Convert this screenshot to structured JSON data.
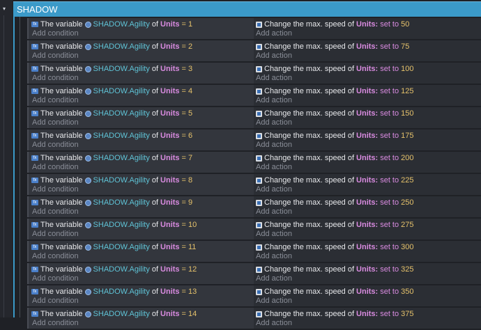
{
  "group": {
    "title": "SHADOW",
    "collapse_symbol": "▾"
  },
  "labels": {
    "the_variable": "The variable",
    "of": "of",
    "add_condition": "Add condition",
    "add_action": "Add action",
    "change_speed": "Change the max. speed of",
    "set_to": "set to"
  },
  "events": [
    {
      "variable": "SHADOW.Agility",
      "object": "Units",
      "op": "=",
      "value": "1",
      "act_object": "Units:",
      "act_value": "50"
    },
    {
      "variable": "SHADOW.Agility",
      "object": "Units",
      "op": "=",
      "value": "2",
      "act_object": "Units:",
      "act_value": "75"
    },
    {
      "variable": "SHADOW.Agility",
      "object": "Units",
      "op": "=",
      "value": "3",
      "act_object": "Units:",
      "act_value": "100"
    },
    {
      "variable": "SHADOW.Agility",
      "object": "Units",
      "op": "=",
      "value": "4",
      "act_object": "Units:",
      "act_value": "125"
    },
    {
      "variable": "SHADOW.Agility",
      "object": "Units",
      "op": "=",
      "value": "5",
      "act_object": "Units:",
      "act_value": "150"
    },
    {
      "variable": "SHADOW.Agility",
      "object": "Units",
      "op": "=",
      "value": "6",
      "act_object": "Units:",
      "act_value": "175"
    },
    {
      "variable": "SHADOW.Agility",
      "object": "Units",
      "op": "=",
      "value": "7",
      "act_object": "Units:",
      "act_value": "200"
    },
    {
      "variable": "SHADOW.Agility",
      "object": "Units",
      "op": "=",
      "value": "8",
      "act_object": "Units:",
      "act_value": "225"
    },
    {
      "variable": "SHADOW.Agility",
      "object": "Units",
      "op": "=",
      "value": "9",
      "act_object": "Units:",
      "act_value": "250"
    },
    {
      "variable": "SHADOW.Agility",
      "object": "Units",
      "op": "=",
      "value": "10",
      "act_object": "Units:",
      "act_value": "275"
    },
    {
      "variable": "SHADOW.Agility",
      "object": "Units",
      "op": "=",
      "value": "11",
      "act_object": "Units:",
      "act_value": "300"
    },
    {
      "variable": "SHADOW.Agility",
      "object": "Units",
      "op": "=",
      "value": "12",
      "act_object": "Units:",
      "act_value": "325"
    },
    {
      "variable": "SHADOW.Agility",
      "object": "Units",
      "op": "=",
      "value": "13",
      "act_object": "Units:",
      "act_value": "350"
    },
    {
      "variable": "SHADOW.Agility",
      "object": "Units",
      "op": "=",
      "value": "14",
      "act_object": "Units:",
      "act_value": "375"
    }
  ]
}
